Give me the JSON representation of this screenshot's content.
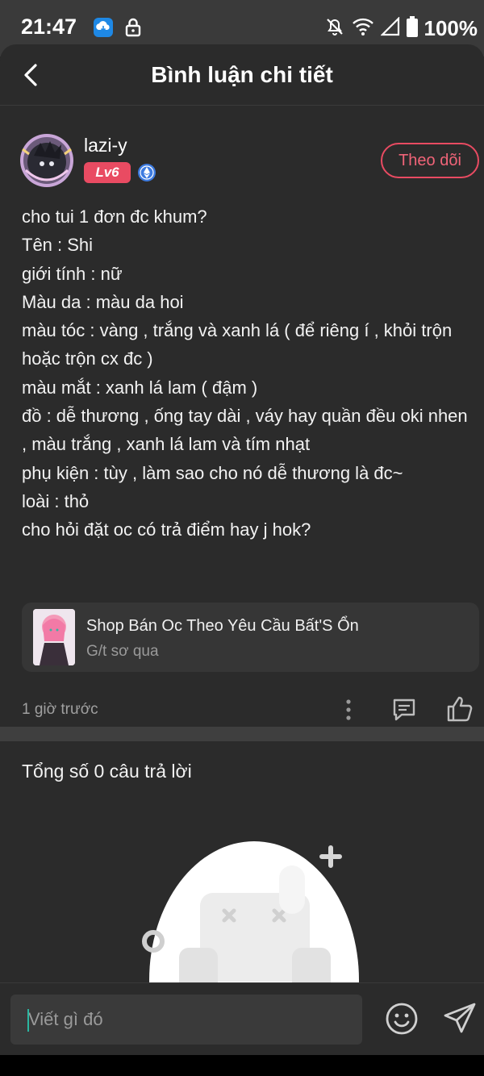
{
  "status_bar": {
    "time": "21:47",
    "battery": "100%",
    "icons": [
      "app-notification-icon",
      "lock-icon",
      "mute-icon",
      "wifi-icon",
      "signal-icon",
      "battery-icon"
    ]
  },
  "header": {
    "title": "Bình luận chi tiết",
    "back_icon": "chevron-left-icon"
  },
  "post": {
    "username": "lazi-y",
    "level": "Lv6",
    "follow_label": "Theo dõi",
    "lines": [
      "cho tui 1 đơn đc khum?",
      "Tên : Shi",
      "giới tính : nữ",
      "Màu da : màu da hoi",
      "màu tóc : vàng , trắng và xanh lá ( để riêng í , khỏi trộn hoặc trộn cx đc )",
      "màu mắt : xanh lá lam ( đậm )",
      "đồ : dễ thương  , ống tay dài , váy hay quần đều oki nhen , màu trắng , xanh lá lam và tím nhạt",
      "phụ kiện : tùy , làm sao cho nó dễ thương là đc~",
      "loài : thỏ",
      "cho hỏi đặt oc có trả điểm hay j hok?"
    ],
    "link_card": {
      "title": "Shop Bán Oc Theo Yêu Cầu Bất'S Ổn",
      "subtitle": "G/t sơ qua"
    },
    "time_ago": "1 giờ trước"
  },
  "replies": {
    "title": "Tổng số 0 câu trả lời"
  },
  "composer": {
    "placeholder": "Viết gì đó"
  },
  "colors": {
    "accent": "#e94b62",
    "background": "#2b2b2b",
    "caret": "#2bb6a0"
  }
}
